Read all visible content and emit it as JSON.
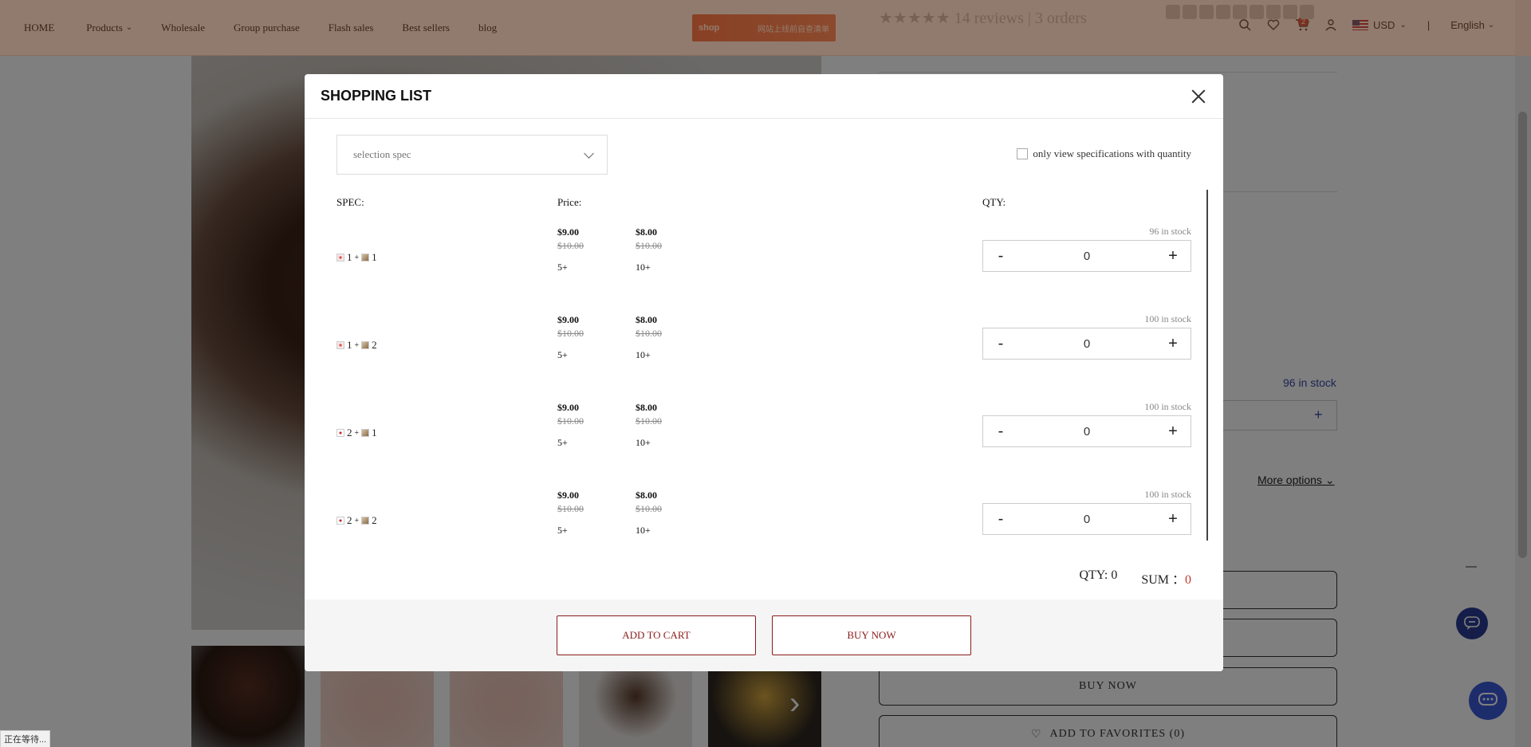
{
  "nav": {
    "items": [
      {
        "label": "HOME"
      },
      {
        "label": "Products",
        "has_dropdown": true
      },
      {
        "label": "Wholesale"
      },
      {
        "label": "Group purchase"
      },
      {
        "label": "Flash sales"
      },
      {
        "label": "Best sellers"
      },
      {
        "label": "blog"
      }
    ],
    "logo_text": "shop",
    "logo_slogan": "网站上线前自查清单",
    "cart_count": "2",
    "currency": "USD",
    "language": "English",
    "separator": "|"
  },
  "background": {
    "reviews_text": "★★★★★ 14 reviews | 3 orders",
    "stock_text": "96 in stock",
    "more_options": "More options",
    "buy_now": "BUY NOW",
    "add_to_favorites": "ADD TO FAVORITES (0)",
    "status_bar": "正在等待..."
  },
  "modal": {
    "title": "SHOPPING LIST",
    "spec_placeholder": "selection spec",
    "only_view_label": "only view specifications with quantity",
    "headers": {
      "spec": "SPEC:",
      "price": "Price:",
      "qty": "QTY:"
    },
    "rows": [
      {
        "spec_a": "1",
        "spec_b": "1",
        "plus": "+",
        "tiers": [
          {
            "price": "$9.00",
            "orig": "$10.00",
            "min": "5+"
          },
          {
            "price": "$8.00",
            "orig": "$10.00",
            "min": "10+"
          }
        ],
        "stock": "96 in stock",
        "qty": "0"
      },
      {
        "spec_a": "1",
        "spec_b": "2",
        "plus": "+",
        "tiers": [
          {
            "price": "$9.00",
            "orig": "$10.00",
            "min": "5+"
          },
          {
            "price": "$8.00",
            "orig": "$10.00",
            "min": "10+"
          }
        ],
        "stock": "100 in stock",
        "qty": "0"
      },
      {
        "spec_a": "2",
        "spec_b": "1",
        "plus": "+",
        "tiers": [
          {
            "price": "$9.00",
            "orig": "$10.00",
            "min": "5+"
          },
          {
            "price": "$8.00",
            "orig": "$10.00",
            "min": "10+"
          }
        ],
        "stock": "100 in stock",
        "qty": "0"
      },
      {
        "spec_a": "2",
        "spec_b": "2",
        "plus": "+",
        "tiers": [
          {
            "price": "$9.00",
            "orig": "$10.00",
            "min": "5+"
          },
          {
            "price": "$8.00",
            "orig": "$10.00",
            "min": "10+"
          }
        ],
        "stock": "100 in stock",
        "qty": "0"
      }
    ],
    "minus_label": "-",
    "plus_label": "+",
    "summary": {
      "qty_label": "QTY: 0",
      "sum_label": "SUM ：",
      "sum_value": "0"
    },
    "add_to_cart": "ADD TO CART",
    "buy_now": "BUY NOW"
  },
  "colors": {
    "accent": "#8a1c1c",
    "sum": "#c0392b",
    "chat": "#3a5bd9"
  }
}
